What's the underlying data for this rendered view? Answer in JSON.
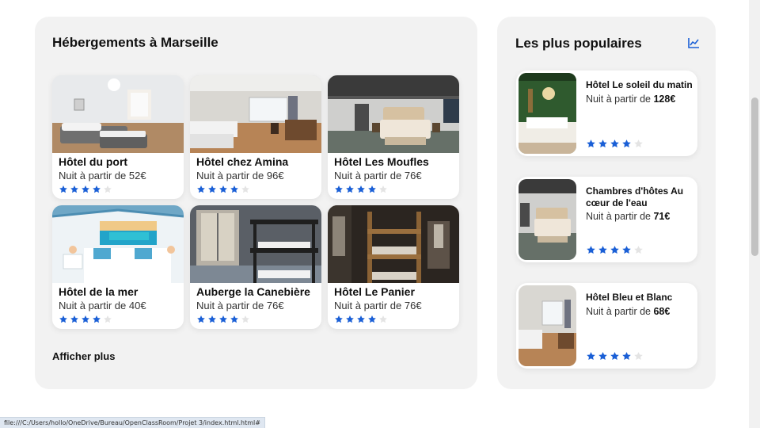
{
  "accommodations": {
    "title": "Hébergements à Marseille",
    "show_more": "Afficher plus",
    "hotels": [
      {
        "name": "Hôtel du port",
        "price": "Nuit à partir de 52€",
        "rating": 4
      },
      {
        "name": "Hôtel chez Amina",
        "price": "Nuit à partir de 96€",
        "rating": 4
      },
      {
        "name": "Hôtel Les Moufles",
        "price": "Nuit à partir de 76€",
        "rating": 4
      },
      {
        "name": "Hôtel de la mer",
        "price": "Nuit à partir de 40€",
        "rating": 4
      },
      {
        "name": "Auberge la Canebière",
        "price": "Nuit à partir de 76€",
        "rating": 4
      },
      {
        "name": "Hôtel Le Panier",
        "price": "Nuit à partir de 76€",
        "rating": 4
      }
    ]
  },
  "popular": {
    "title": "Les plus populaires",
    "icon": "chart-line-icon",
    "items": [
      {
        "name": "Hôtel Le soleil du matin",
        "price_prefix": "Nuit à partir de ",
        "price_value": "128€",
        "rating": 4
      },
      {
        "name": "Chambres d'hôtes Au cœur de l'eau",
        "price_prefix": "Nuit à partir de ",
        "price_value": "71€",
        "rating": 4
      },
      {
        "name": "Hôtel Bleu et Blanc",
        "price_prefix": "Nuit à partir de ",
        "price_value": "68€",
        "rating": 4
      }
    ]
  },
  "status_bar": {
    "url": "file:///C:/Users/hollo/OneDrive/Bureau/OpenClassRoom/Projet 3/index.html.html#"
  },
  "colors": {
    "star_filled": "#1a5fd6",
    "star_empty": "#e4e4e4",
    "panel_bg": "#f2f2f2"
  }
}
